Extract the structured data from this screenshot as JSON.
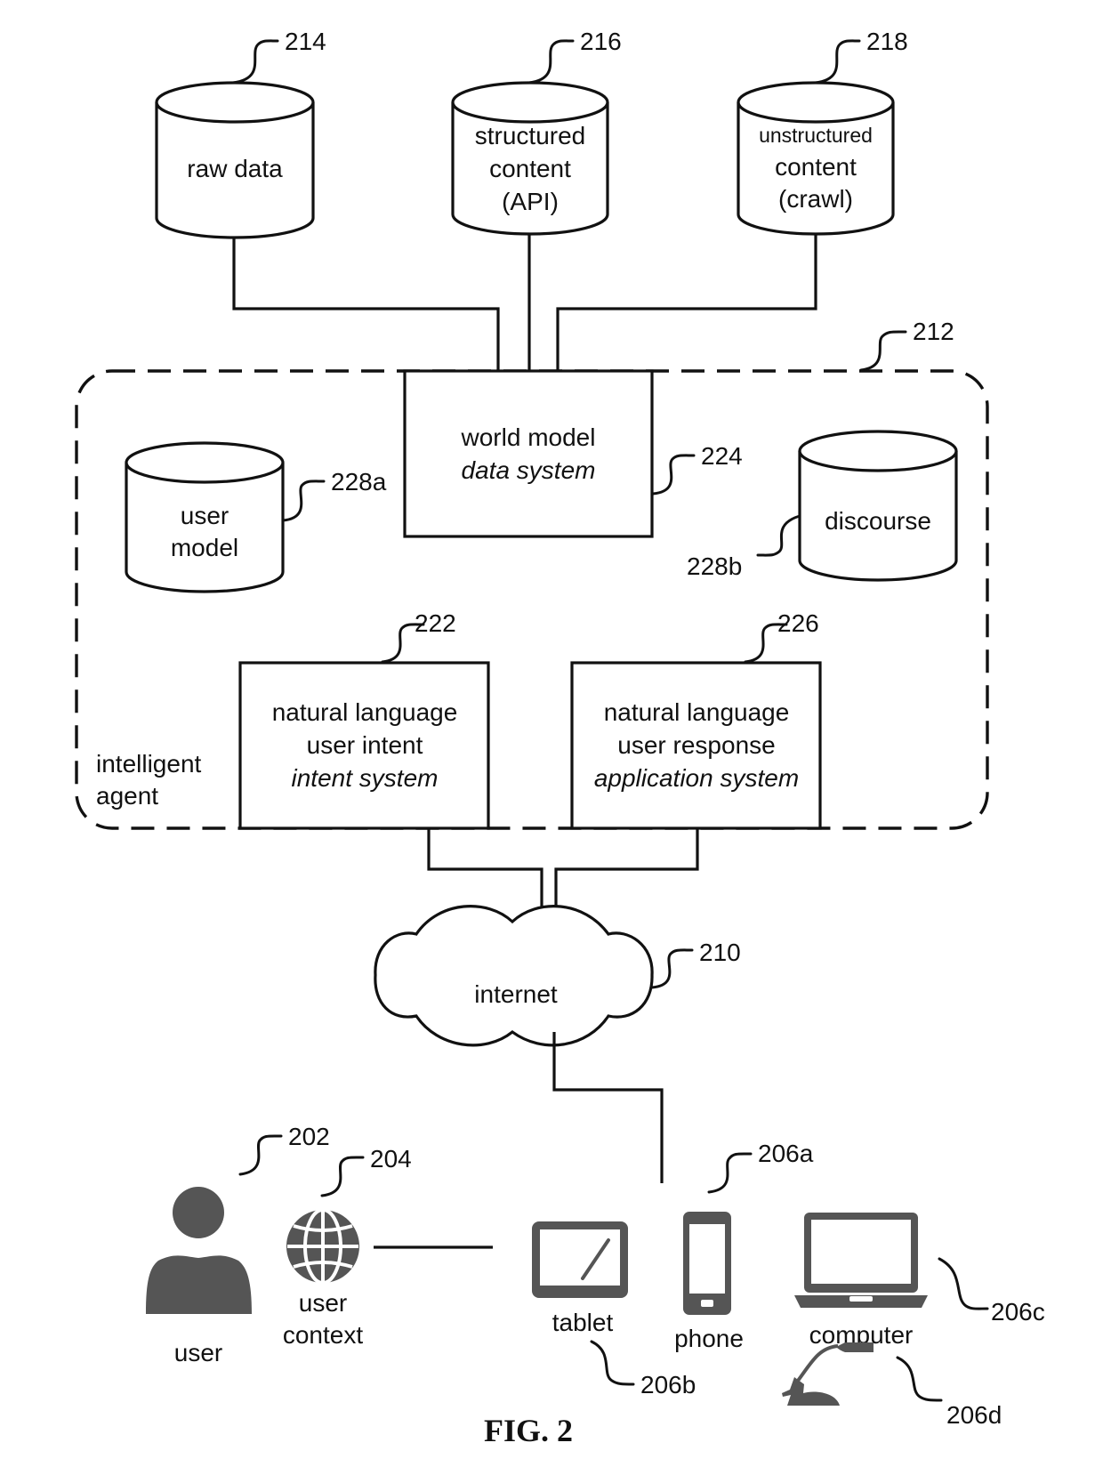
{
  "figure": {
    "caption": "FIG. 2",
    "colors": {
      "line": "#111111",
      "icon_fill": "#555555",
      "background": "#ffffff"
    }
  },
  "data_sources": [
    {
      "ref": "214",
      "lines": [
        "raw data"
      ]
    },
    {
      "ref": "216",
      "lines": [
        "structured",
        "content",
        "(API)"
      ]
    },
    {
      "ref": "218",
      "lines": [
        "unstructured",
        "content",
        "(crawl)"
      ]
    }
  ],
  "agent": {
    "ref": "212",
    "label_lines": [
      "intelligent",
      "agent"
    ],
    "world_model": {
      "ref": "224",
      "line1": "world model",
      "line2": "data system"
    },
    "user_model": {
      "ref": "228a",
      "lines": [
        "user",
        "model"
      ]
    },
    "discourse": {
      "ref": "228b",
      "label": "discourse"
    },
    "intent": {
      "ref": "222",
      "line1": "natural language",
      "line2": "user intent",
      "line3": "intent system"
    },
    "response": {
      "ref": "226",
      "line1": "natural language",
      "line2": "user response",
      "line3": "application system"
    }
  },
  "network": {
    "ref": "210",
    "label": "internet"
  },
  "user_side": {
    "user": {
      "ref": "202",
      "label": "user",
      "icon": "person-icon"
    },
    "context": {
      "ref": "204",
      "lines": [
        "user",
        "context"
      ],
      "icon": "globe-icon"
    }
  },
  "devices": [
    {
      "ref": "206a",
      "label": "phone",
      "icon": "phone-icon"
    },
    {
      "ref": "206b",
      "label": "tablet",
      "icon": "tablet-icon"
    },
    {
      "ref": "206c",
      "label": "computer",
      "icon": "laptop-icon"
    },
    {
      "ref": "206d",
      "label": "",
      "icon": "microphone-icon"
    }
  ]
}
